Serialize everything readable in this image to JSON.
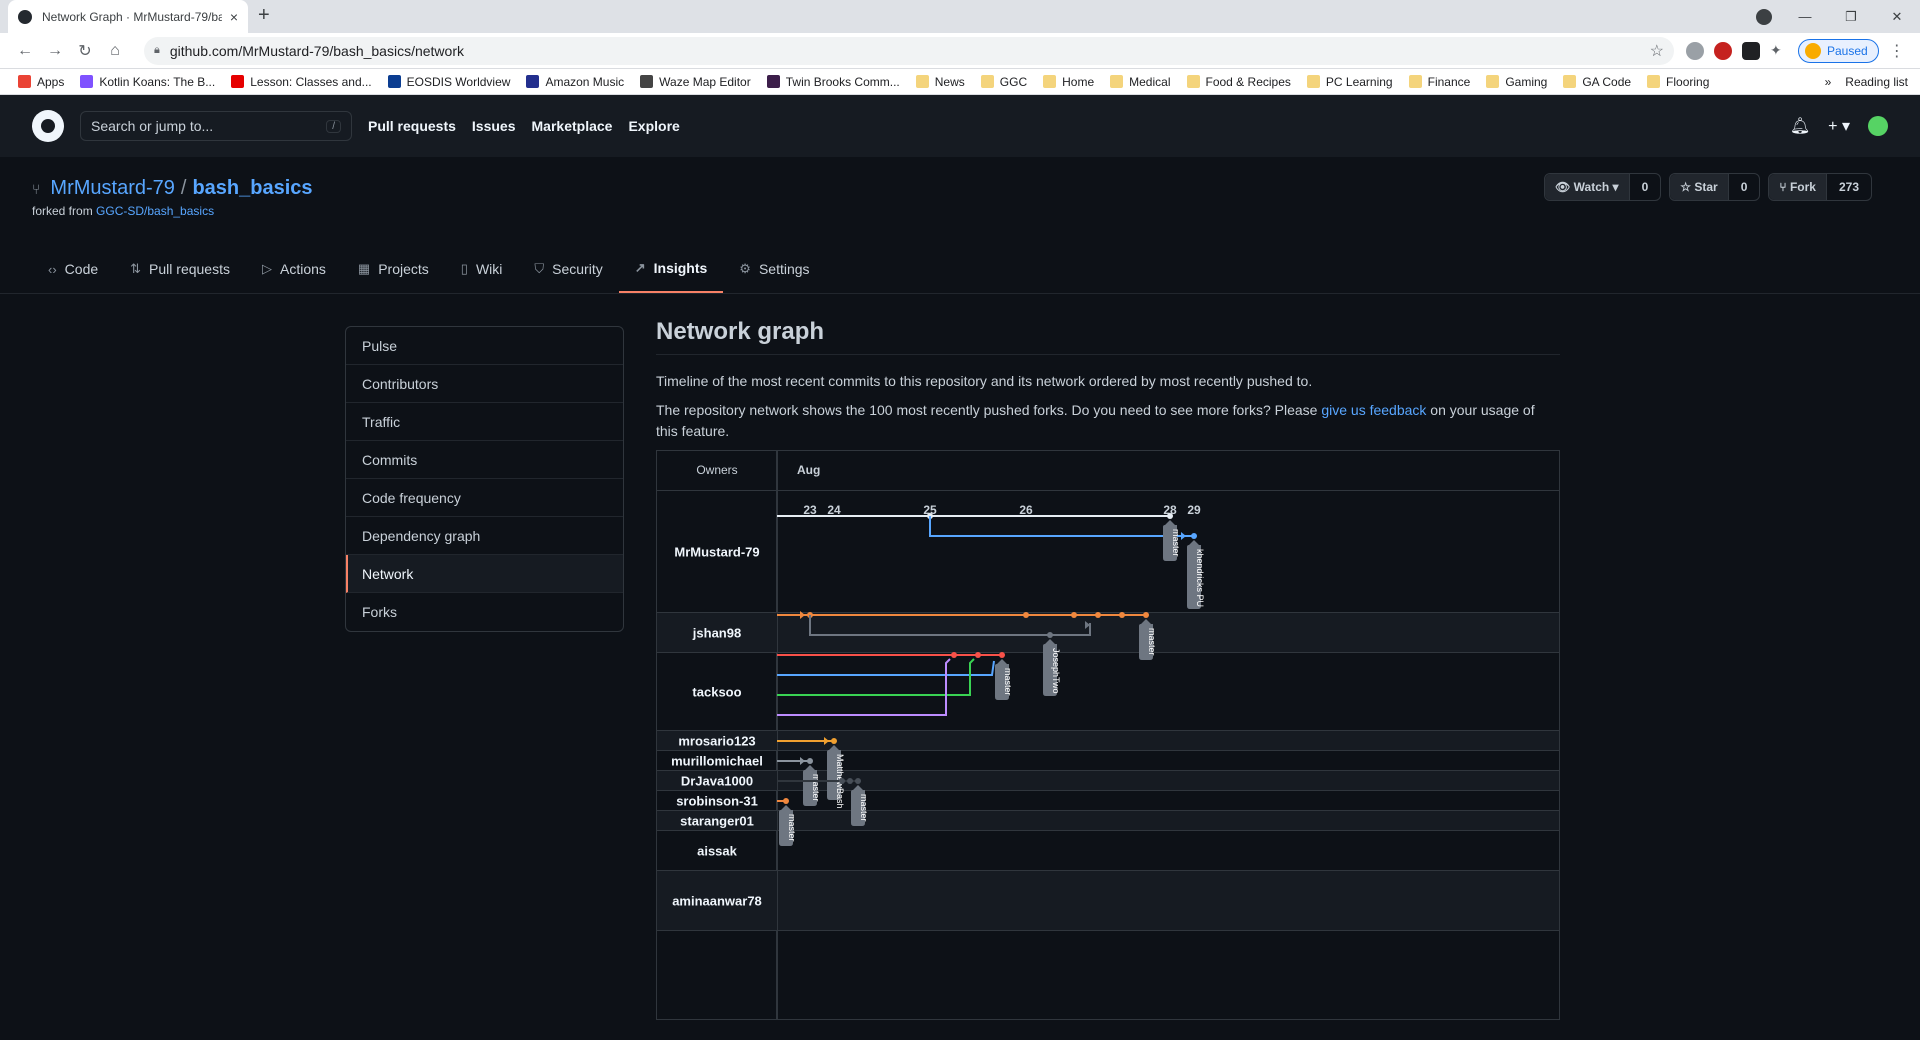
{
  "browser": {
    "tab_title": "Network Graph · MrMustard-79/bash_basics",
    "tab_close": "×",
    "new_tab": "+",
    "url": "github.com/MrMustard-79/bash_basics/network",
    "profile_label": "Paused",
    "window_controls": [
      "—",
      "❐",
      "✕"
    ],
    "bookmarks": [
      {
        "label": "Apps",
        "icon": "apps-grid-icon",
        "color": "#ea4335"
      },
      {
        "label": "Kotlin Koans: The B...",
        "icon": "kotlin-icon",
        "color": "#7f52ff"
      },
      {
        "label": "Lesson: Classes and...",
        "icon": "oracle-icon",
        "color": "#e60000"
      },
      {
        "label": "EOSDIS Worldview",
        "icon": "nasa-icon",
        "color": "#0b3d91"
      },
      {
        "label": "Amazon Music",
        "icon": "amazon-music-icon",
        "color": "#232f8e"
      },
      {
        "label": "Waze Map Editor",
        "icon": "waze-icon",
        "color": "#444444"
      },
      {
        "label": "Twin Brooks Comm...",
        "icon": "site-icon",
        "color": "#3c1e4a"
      },
      {
        "label": "News",
        "icon": "folder-icon",
        "color": "#f4d47c"
      },
      {
        "label": "GGC",
        "icon": "folder-icon",
        "color": "#f4d47c"
      },
      {
        "label": "Home",
        "icon": "folder-icon",
        "color": "#f4d47c"
      },
      {
        "label": "Medical",
        "icon": "folder-icon",
        "color": "#f4d47c"
      },
      {
        "label": "Food & Recipes",
        "icon": "folder-icon",
        "color": "#f4d47c"
      },
      {
        "label": "PC Learning",
        "icon": "folder-icon",
        "color": "#f4d47c"
      },
      {
        "label": "Finance",
        "icon": "folder-icon",
        "color": "#f4d47c"
      },
      {
        "label": "Gaming",
        "icon": "folder-icon",
        "color": "#f4d47c"
      },
      {
        "label": "GA Code",
        "icon": "folder-icon",
        "color": "#f4d47c"
      },
      {
        "label": "Flooring",
        "icon": "folder-icon",
        "color": "#f4d47c"
      }
    ],
    "bookmarks_overflow": "»",
    "reading_list": "Reading list"
  },
  "github": {
    "search_placeholder": "Search or jump to...",
    "search_shortcut": "/",
    "nav": [
      "Pull requests",
      "Issues",
      "Marketplace",
      "Explore"
    ],
    "repo": {
      "owner": "MrMustard-79",
      "separator": "/",
      "name": "bash_basics",
      "forked_prefix": "forked from ",
      "forked_from": "GGC-SD/bash_basics",
      "watch_label": "Watch ▾",
      "watch_count": "0",
      "star_label": "Star",
      "star_count": "0",
      "fork_label": "Fork",
      "fork_count": "273"
    },
    "tabs": [
      {
        "label": "Code",
        "icon": "‹›",
        "name": "code"
      },
      {
        "label": "Pull requests",
        "icon": "⇅",
        "name": "pull-requests"
      },
      {
        "label": "Actions",
        "icon": "▷",
        "name": "actions"
      },
      {
        "label": "Projects",
        "icon": "▦",
        "name": "projects"
      },
      {
        "label": "Wiki",
        "icon": "▯",
        "name": "wiki"
      },
      {
        "label": "Security",
        "icon": "⛉",
        "name": "security"
      },
      {
        "label": "Insights",
        "icon": "↗",
        "name": "insights",
        "active": true
      },
      {
        "label": "Settings",
        "icon": "⚙",
        "name": "settings"
      }
    ],
    "insights_menu": [
      "Pulse",
      "Contributors",
      "Traffic",
      "Commits",
      "Code frequency",
      "Dependency graph",
      "Network",
      "Forks"
    ],
    "insights_selected": "Network",
    "page_title": "Network graph",
    "desc1": "Timeline of the most recent commits to this repository and its network ordered by most recently pushed to.",
    "desc2_before": "The repository network shows the 100 most recently pushed forks. Do you need to see more forks? Please ",
    "desc2_link": "give us feedback",
    "desc2_after": " on your usage of this feature.",
    "graph": {
      "owners_header": "Owners",
      "month": "Aug",
      "days": [
        "23",
        "24",
        "25",
        "26",
        "28",
        "29"
      ],
      "owners": [
        "MrMustard-79",
        "jshan98",
        "tacksoo",
        "mrosario123",
        "murillomichael",
        "DrJava1000",
        "srobinson-31",
        "staranger01",
        "aissak",
        "aminaanwar78"
      ],
      "branch_labels": [
        "master",
        "khendricks PU",
        "master",
        "JosephTwo",
        "master",
        "MatthewBash",
        "master",
        "master",
        "master"
      ]
    }
  }
}
